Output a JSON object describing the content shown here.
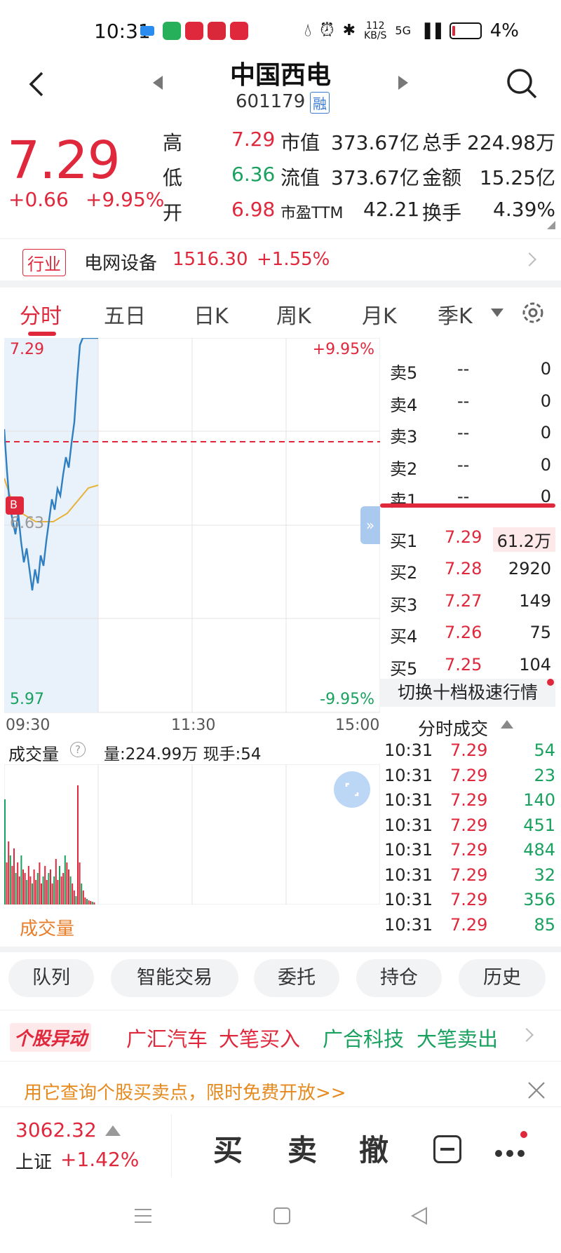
{
  "status_bar": {
    "time": "10:31",
    "net_speed": "112",
    "net_unit": "KB/S",
    "network": "5G",
    "battery": "4%"
  },
  "header": {
    "title": "中国西电",
    "code": "601179",
    "badge": "融"
  },
  "quote": {
    "price": "7.29",
    "change": "+0.66",
    "change_pct": "+9.95%",
    "rows": [
      [
        {
          "l": "高",
          "v": "7.29",
          "c": "red"
        },
        {
          "l": "市值",
          "v": "373.67亿"
        },
        {
          "l": "总手",
          "v": "224.98万"
        }
      ],
      [
        {
          "l": "低",
          "v": "6.36",
          "c": "green"
        },
        {
          "l": "流值",
          "v": "373.67亿"
        },
        {
          "l": "金额",
          "v": "15.25亿"
        }
      ],
      [
        {
          "l": "开",
          "v": "6.98",
          "c": "red"
        },
        {
          "l": "市盈TTM",
          "v": "42.21"
        },
        {
          "l": "换手",
          "v": "4.39%"
        }
      ]
    ]
  },
  "industry": {
    "tag": "行业",
    "name": "电网设备",
    "value": "1516.30",
    "change": "+1.55%"
  },
  "tabs": [
    "分时",
    "五日",
    "日K",
    "周K",
    "月K",
    "季K"
  ],
  "chart": {
    "price_top": "7.29",
    "pct_top": "+9.95%",
    "price_bottom": "5.97",
    "pct_bottom": "-9.95%",
    "avg_label": "6.63",
    "buy_marker": "B",
    "times": [
      "09:30",
      "11:30",
      "15:00"
    ]
  },
  "order_book": {
    "sells": [
      {
        "label": "卖5",
        "price": "--",
        "vol": "0"
      },
      {
        "label": "卖4",
        "price": "--",
        "vol": "0"
      },
      {
        "label": "卖3",
        "price": "--",
        "vol": "0"
      },
      {
        "label": "卖2",
        "price": "--",
        "vol": "0"
      },
      {
        "label": "卖1",
        "price": "--",
        "vol": "0"
      }
    ],
    "buys": [
      {
        "label": "买1",
        "price": "7.29",
        "vol": "61.2万"
      },
      {
        "label": "买2",
        "price": "7.28",
        "vol": "2920"
      },
      {
        "label": "买3",
        "price": "7.27",
        "vol": "149"
      },
      {
        "label": "买4",
        "price": "7.26",
        "vol": "75"
      },
      {
        "label": "买5",
        "price": "7.25",
        "vol": "104"
      }
    ],
    "switch_label": "切换十档极速行情",
    "trades_title": "分时成交"
  },
  "trades": [
    {
      "t": "10:31",
      "p": "7.29",
      "v": "54"
    },
    {
      "t": "10:31",
      "p": "7.29",
      "v": "23"
    },
    {
      "t": "10:31",
      "p": "7.29",
      "v": "140"
    },
    {
      "t": "10:31",
      "p": "7.29",
      "v": "451"
    },
    {
      "t": "10:31",
      "p": "7.29",
      "v": "484"
    },
    {
      "t": "10:31",
      "p": "7.29",
      "v": "32"
    },
    {
      "t": "10:31",
      "p": "7.29",
      "v": "356"
    },
    {
      "t": "10:31",
      "p": "7.29",
      "v": "85"
    }
  ],
  "volume": {
    "title": "成交量",
    "summary": "量:224.99万 现手:54",
    "footer": "成交量"
  },
  "actions": [
    "队列",
    "智能交易",
    "委托",
    "持仓",
    "历史"
  ],
  "ticker": {
    "badge": "个股异动",
    "items": [
      {
        "text": "广汇汽车",
        "c": "red"
      },
      {
        "text": "大笔买入",
        "c": "red"
      },
      {
        "text": "广合科技",
        "c": "green"
      },
      {
        "text": "大笔卖出",
        "c": "green"
      }
    ]
  },
  "promo": "用它查询个股买卖点，限时免费开放>>",
  "bottom": {
    "index_value": "3062.32",
    "index_name": "上证",
    "index_change": "+1.42%",
    "buy": "买",
    "sell": "卖",
    "cancel": "撤"
  },
  "colors": {
    "up": "#e0283c",
    "down": "#19a15f",
    "price_line": "#2f7fc1",
    "avg_line": "#e8b23a"
  }
}
